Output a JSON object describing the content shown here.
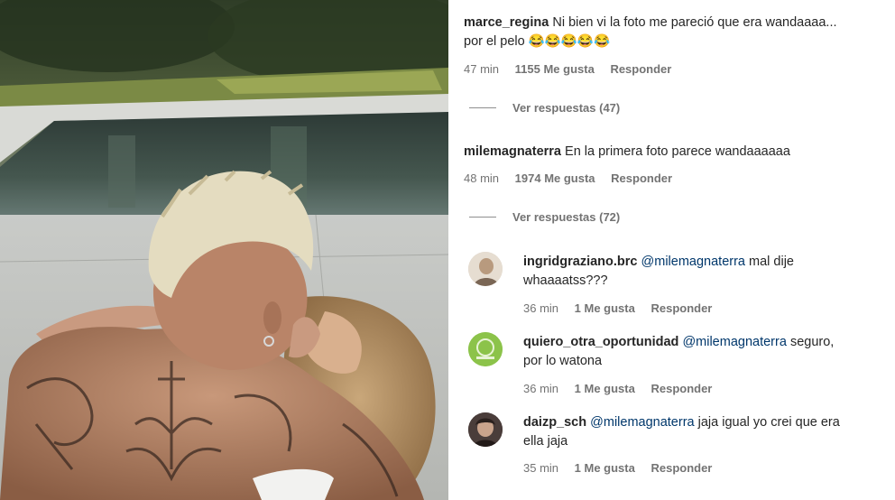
{
  "comments": [
    {
      "user": "marce_regina",
      "text_line1": "Ni bien vi la foto me pareció que era wandaaaa...",
      "text_line2": "por el pelo",
      "emojis": "😂😂😂😂😂",
      "time": "47 min",
      "likes": "1155 Me gusta",
      "reply": "Responder",
      "view_replies": "Ver respuestas (47)"
    },
    {
      "user": "milemagnaterra",
      "text_line1": "En la primera foto parece wandaaaaaa",
      "time": "48 min",
      "likes": "1974 Me gusta",
      "reply": "Responder",
      "view_replies": "Ver respuestas (72)"
    }
  ],
  "replies": [
    {
      "user": "ingridgraziano.brc",
      "mention": "@milemagnaterra",
      "text_line1": "mal dije",
      "text_line2": "whaaaatss???",
      "time": "36 min",
      "likes": "1 Me gusta",
      "reply": "Responder"
    },
    {
      "user": "quiero_otra_oportunidad",
      "mention": "@milemagnaterra",
      "text_line1": "seguro,",
      "text_line2": "por lo watona",
      "time": "36 min",
      "likes": "1 Me gusta",
      "reply": "Responder"
    },
    {
      "user": "daizp_sch",
      "mention": "@milemagnaterra",
      "text_line1": "jaja igual yo crei que era",
      "text_line2": "ella jaja",
      "time": "35 min",
      "likes": "1 Me gusta",
      "reply": "Responder"
    }
  ],
  "colors": {
    "username": "#262626",
    "mention": "#00376b",
    "meta": "#737373"
  }
}
